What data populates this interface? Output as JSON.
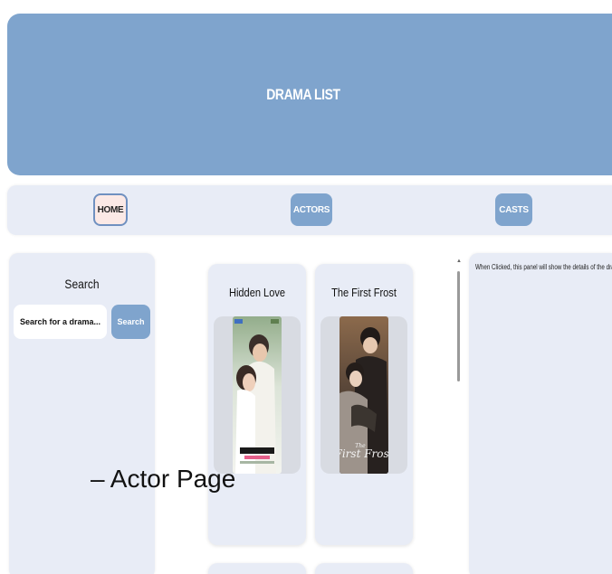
{
  "header": {
    "title": "DRAMA LIST"
  },
  "nav": {
    "home": "HOME",
    "actors": "ACTORS",
    "casts": "CASTS"
  },
  "search": {
    "title": "Search",
    "placeholder": "Search for a drama...",
    "button": "Search"
  },
  "dramas": [
    {
      "title": "Hidden Love"
    },
    {
      "title": "The First Frost"
    }
  ],
  "details": {
    "text": "When Clicked, this panel will show the details of the drama."
  },
  "caption": "– Actor Page",
  "colors": {
    "accent": "#7fa4cd",
    "panel": "#e8ecf6",
    "home": "#fbe9e6"
  }
}
